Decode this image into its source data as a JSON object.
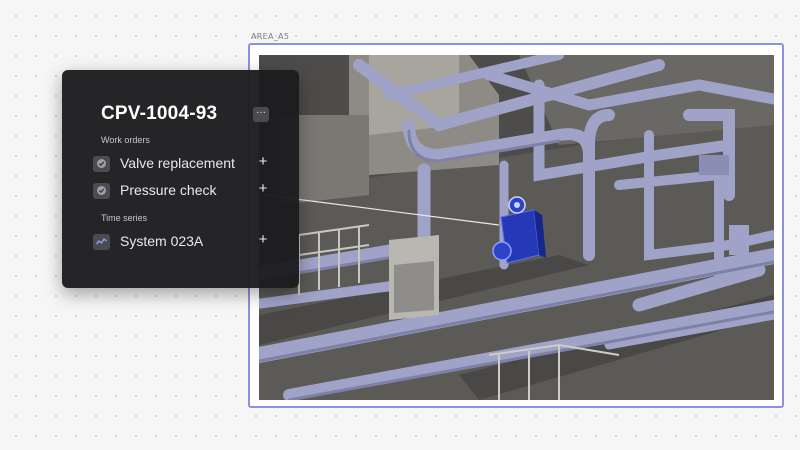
{
  "area": {
    "label": "AREA_A5"
  },
  "panel": {
    "title": "CPV-1004-93",
    "more_label": "···",
    "sections": [
      {
        "label": "Work orders",
        "items": [
          {
            "label": "Valve replacement",
            "icon": "check-circle-icon",
            "action": "+"
          },
          {
            "label": "Pressure check",
            "icon": "check-circle-icon",
            "action": "+"
          }
        ]
      },
      {
        "label": "Time series",
        "items": [
          {
            "label": "System 023A",
            "icon": "line-chart-icon",
            "action": "+"
          }
        ]
      }
    ]
  },
  "colors": {
    "panel_bg": "#1c1c1f",
    "frame_border": "#8e90e0",
    "pipe": "#9fa3c8",
    "selected_equipment": "#2438b8"
  }
}
